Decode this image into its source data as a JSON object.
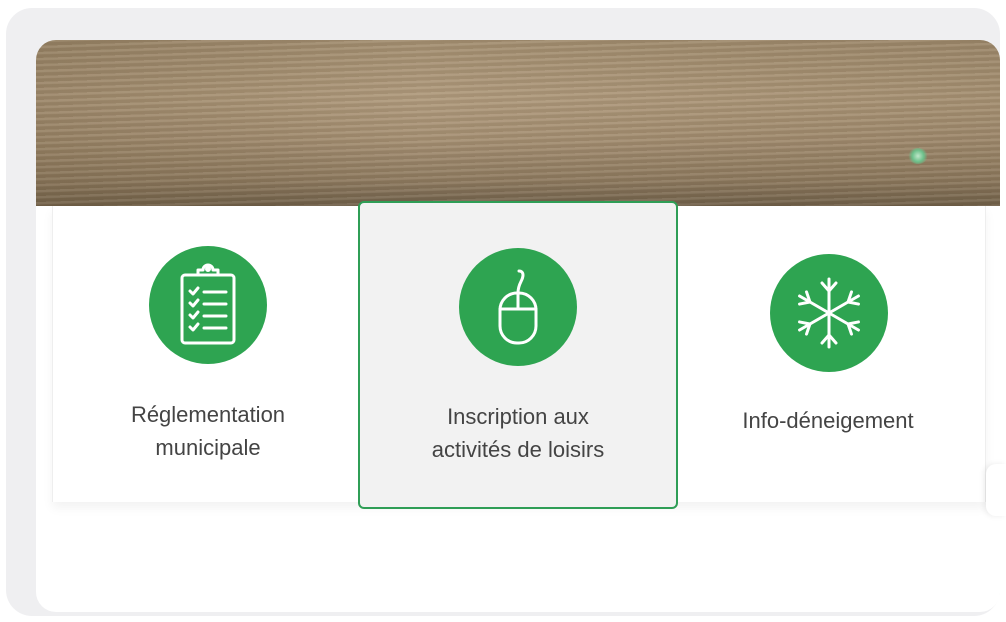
{
  "tiles": [
    {
      "icon": "clipboard-checklist-icon",
      "line1": "Réglementation",
      "line2": "municipale"
    },
    {
      "icon": "computer-mouse-icon",
      "line1": "Inscription aux",
      "line2": "activités de loisirs"
    },
    {
      "icon": "snowflake-icon",
      "line1": "Info-déneigement",
      "line2": ""
    }
  ],
  "colors": {
    "accent": "#2ea451",
    "highlight_border": "#2f9e56",
    "highlight_bg": "#f2f2f2",
    "label_text": "#444444"
  }
}
